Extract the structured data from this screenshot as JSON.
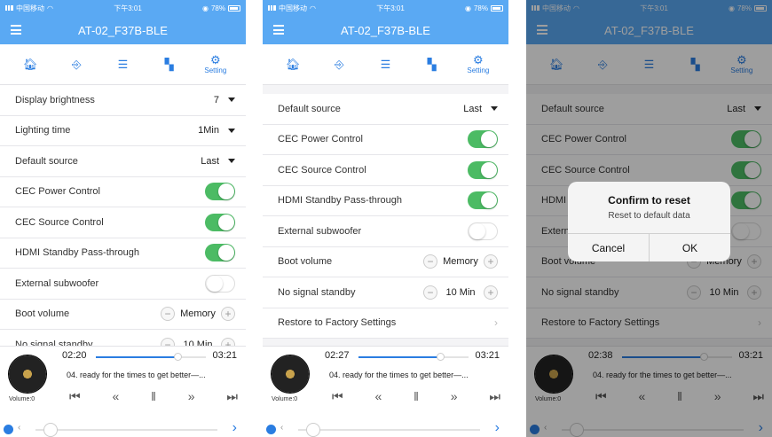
{
  "status": {
    "carrier": "中国移动",
    "time": "下午3:01",
    "battery": "78%"
  },
  "app_title": "AT-02_F37B-BLE",
  "tabs": {
    "setting_label": "Setting"
  },
  "screen1": {
    "rows": [
      {
        "label": "Display brightness",
        "value": "7"
      },
      {
        "label": "Lighting time",
        "value": "1Min"
      },
      {
        "label": "Default source",
        "value": "Last"
      },
      {
        "label": "CEC Power Control",
        "toggle": "on"
      },
      {
        "label": "CEC Source Control",
        "toggle": "on"
      },
      {
        "label": "HDMI Standby Pass-through",
        "toggle": "on"
      },
      {
        "label": "External subwoofer",
        "toggle": "off"
      },
      {
        "label": "Boot volume",
        "value": "Memory"
      },
      {
        "label": "No signal standby",
        "value": "10  Min"
      }
    ],
    "player": {
      "elapsed": "02:20",
      "total": "03:21",
      "progress": 0.74
    }
  },
  "screen2": {
    "rows": [
      {
        "label": "Default source",
        "value": "Last"
      },
      {
        "label": "CEC Power Control",
        "toggle": "on"
      },
      {
        "label": "CEC Source Control",
        "toggle": "on"
      },
      {
        "label": "HDMI Standby Pass-through",
        "toggle": "on"
      },
      {
        "label": "External subwoofer",
        "toggle": "off"
      },
      {
        "label": "Boot volume",
        "value": "Memory"
      },
      {
        "label": "No signal standby",
        "value": "10  Min"
      },
      {
        "label": "Restore to Factory Settings"
      }
    ],
    "player": {
      "elapsed": "02:27",
      "total": "03:21",
      "progress": 0.74
    }
  },
  "screen3": {
    "player": {
      "elapsed": "02:38",
      "total": "03:21",
      "progress": 0.74
    },
    "dialog": {
      "title": "Confirm to reset",
      "message": "Reset to default data",
      "cancel": "Cancel",
      "ok": "OK"
    }
  },
  "player_common": {
    "song": "04.   ready for the times to get better—...",
    "volume_label": "Volume:0"
  },
  "colors": {
    "header": "#5aa9f3",
    "accent": "#2a7de1",
    "toggle_on": "#4cbb64"
  },
  "icons": [
    "home-icon",
    "input-icon",
    "equalizer-icon",
    "pages-icon",
    "gear-icon"
  ]
}
